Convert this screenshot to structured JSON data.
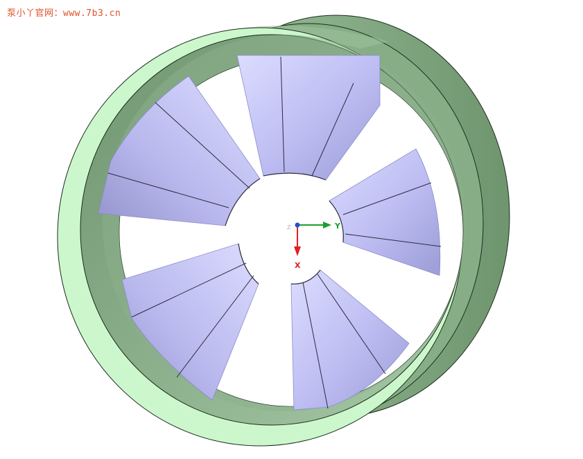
{
  "watermark": "泵小丫官网：www.7b3.cn",
  "triad": {
    "y_label": "Y",
    "x_label": "X",
    "z_label": "Z",
    "y_color": "#1e9e2c",
    "x_color": "#e02020",
    "z_color": "#2050d0"
  },
  "colors": {
    "rim_face": "#ccf7cc",
    "rim_side": "#8fb88f",
    "rim_dark": "#6f956f",
    "blade_light": "#d8d8ff",
    "blade_mid": "#b4b4ee",
    "blade_dark": "#9898d0",
    "edge": "#1a2a1a"
  },
  "blades": [
    {
      "name": "blade-top"
    },
    {
      "name": "blade-upper-left"
    },
    {
      "name": "blade-right"
    },
    {
      "name": "blade-lower-left"
    },
    {
      "name": "blade-bottom"
    }
  ]
}
